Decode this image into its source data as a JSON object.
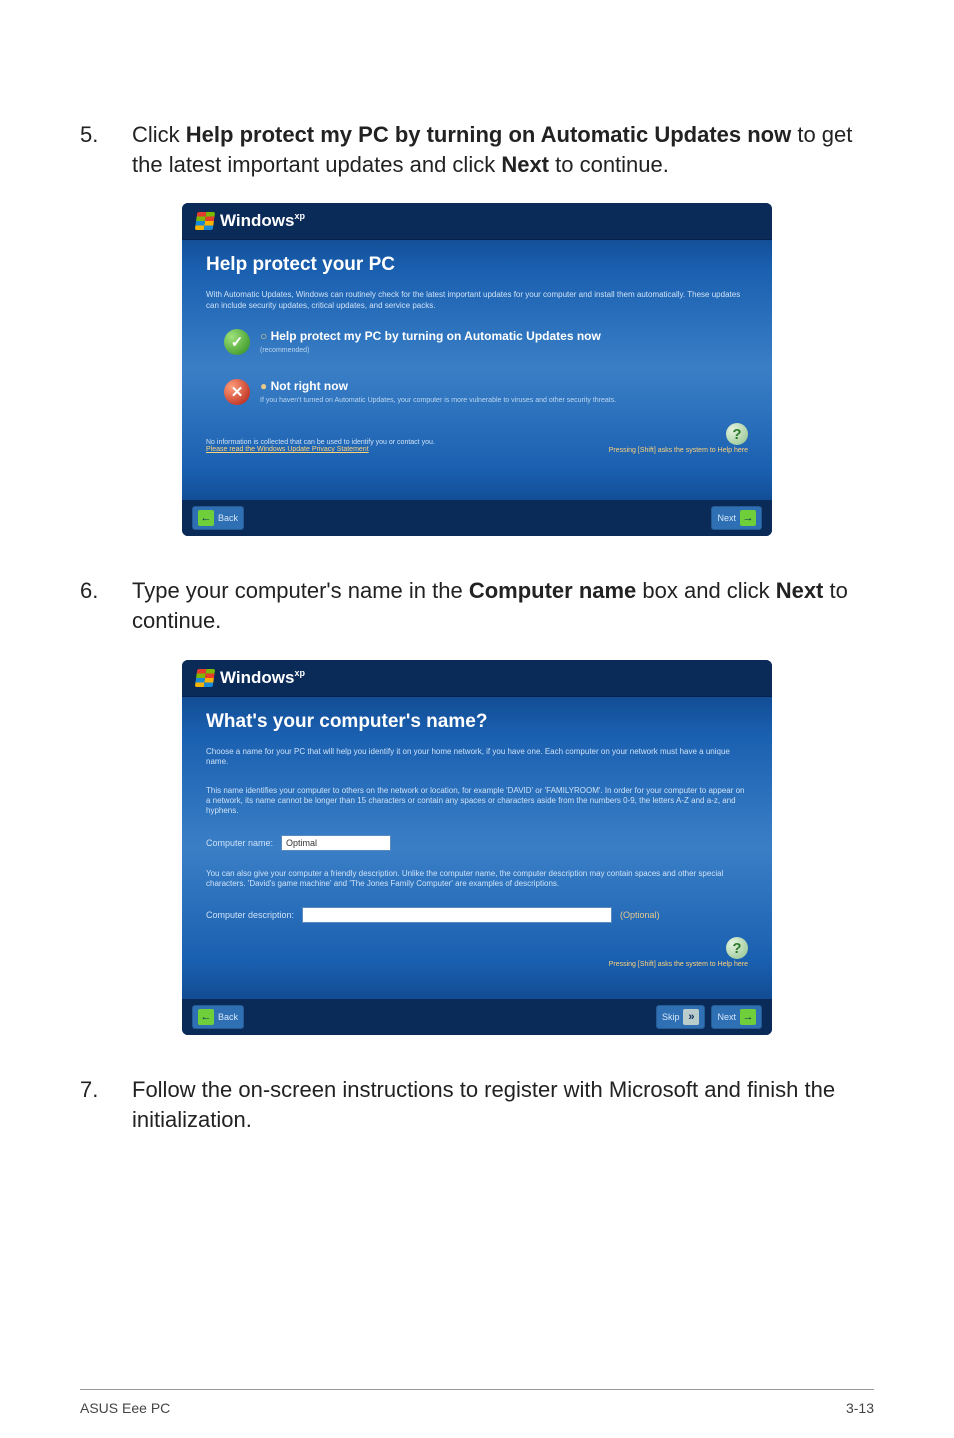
{
  "steps": {
    "s5": {
      "num": "5.",
      "text_before": "Click ",
      "bold1": "Help protect my PC by turning on Automatic Updates now",
      "mid1": " to get the latest important updates and click ",
      "bold2": "Next",
      "mid2": " to continue."
    },
    "s6": {
      "num": "6.",
      "text_before": "Type your computer's name in the ",
      "bold1": "Computer name",
      "mid1": " box and click ",
      "bold2": "Next",
      "mid2": " to continue."
    },
    "s7": {
      "num": "7.",
      "text": "Follow the on-screen instructions to register with Microsoft and finish the initialization."
    }
  },
  "win_common": {
    "brand_html": "Windows",
    "brand_sup": "xp",
    "help_link_label": "Pressing [Shift] asks the system to Help here"
  },
  "shot1": {
    "title": "Help protect your PC",
    "desc": "With Automatic Updates, Windows can routinely check for the latest important updates for your computer and install them automatically. These updates can include security updates, critical updates, and service packs.",
    "opt1_title": "Help protect my PC by turning on Automatic Updates now",
    "opt1_sub": "(recommended)",
    "opt2_title": "Not right now",
    "opt2_sub": "If you haven't turned on Automatic Updates, your computer is more vulnerable to viruses and other security threats.",
    "bottom_text": "No information is collected that can be used to identify you or contact you.",
    "bottom_link": "Please read the Windows Update Privacy Statement",
    "back": "Back",
    "next": "Next"
  },
  "shot2": {
    "title": "What's your computer's name?",
    "desc1": "Choose a name for your PC that will help you identify it on your home network, if you have one. Each computer on your network must have a unique name.",
    "desc2": "This name identifies your computer to others on the network or location, for example 'DAVID' or 'FAMILYROOM'. In order for your computer to appear on a network, its name cannot be longer than 15 characters or contain any spaces or characters aside from the numbers 0-9, the letters A-Z and a-z, and hyphens.",
    "comp_name_label": "Computer name:",
    "comp_name_value": "Optimal",
    "desc3": "You can also give your computer a friendly description. Unlike the computer name, the computer description may contain spaces and other special characters. 'David's game machine' and 'The Jones Family Computer' are examples of descriptions.",
    "comp_desc_label": "Computer description:",
    "comp_desc_hint": "(Optional)",
    "back": "Back",
    "skip": "Skip",
    "next": "Next"
  },
  "footer": {
    "left": "ASUS Eee PC",
    "right": "3-13"
  }
}
